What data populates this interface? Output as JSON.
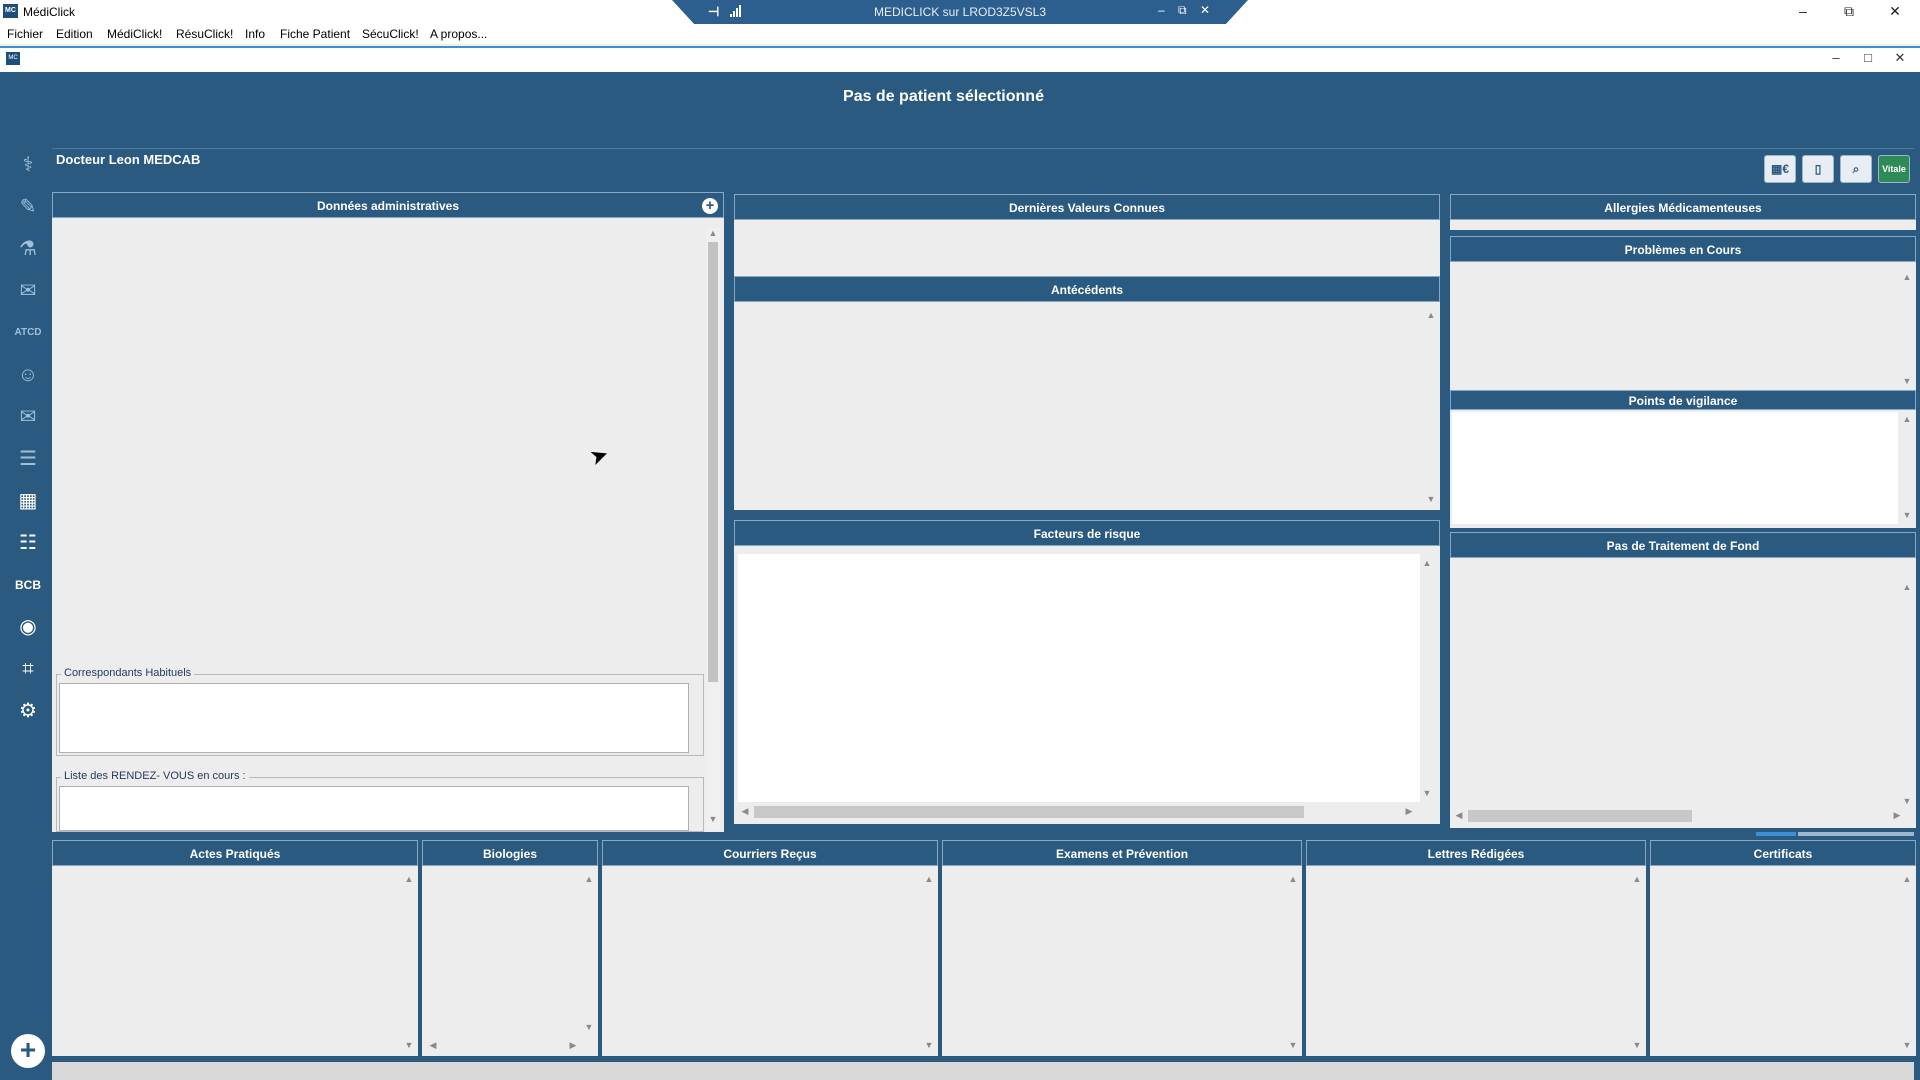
{
  "window": {
    "title": "MédiClick",
    "app_icon": "MC"
  },
  "remote": {
    "title": "MEDICLICK sur LROD3Z5VSL3",
    "pin_icon": "pin-icon",
    "signal_icon": "signal-icon",
    "min": "–",
    "restore": "⧉",
    "close": "✕"
  },
  "menu": [
    "Fichier",
    "Edition",
    "MédiClick!",
    "RésuClick!",
    "Info",
    "Fiche Patient",
    "SécuClick!",
    "A propos..."
  ],
  "banner": "Pas de patient sélectionné",
  "doctor": "Docteur Leon MEDCAB",
  "toolbar": [
    "▦€",
    "▯",
    "⌕",
    "Vitale"
  ],
  "sidebar": {
    "icons": [
      "stethoscope-icon",
      "syringe-icon",
      "microscope-icon",
      "mail-icon",
      "atcd-icon",
      "patient-icon",
      "letter-icon",
      "document-icon",
      "calendar-icon",
      "contact-card-icon",
      "bcb-icon",
      "camera-icon",
      "scan-icon",
      "settings-icon"
    ],
    "glyphs": [
      "⚕",
      "✎",
      "⚗",
      "✉",
      "ATCD",
      "☺",
      "✉",
      "☰",
      "▦",
      "☷",
      "BCB",
      "◉",
      "⌗",
      "⚙"
    ],
    "add": "+"
  },
  "panels": {
    "admin": "Données administratives",
    "admin_add": "+",
    "correspondants": "Correspondants Habituels",
    "rdv": "Liste des RENDEZ- VOUS en cours :",
    "dernieres": "Dernières Valeurs Connues",
    "antecedents": "Antécédents",
    "facteurs": "Facteurs de risque",
    "allergies": "Allergies Médicamenteuses",
    "problemes": "Problèmes en Cours",
    "vigilance": "Points de vigilance",
    "traitement": "Pas de Traitement de Fond"
  },
  "bottom": [
    "Actes Pratiqués",
    "Biologies",
    "Courriers Reçus",
    "Examens et Prévention",
    "Lettres Rédigées",
    "Certificats"
  ],
  "colors": {
    "header": "#2b5a80",
    "panel_bg": "#ededed",
    "accent": "#3e8ed6"
  }
}
